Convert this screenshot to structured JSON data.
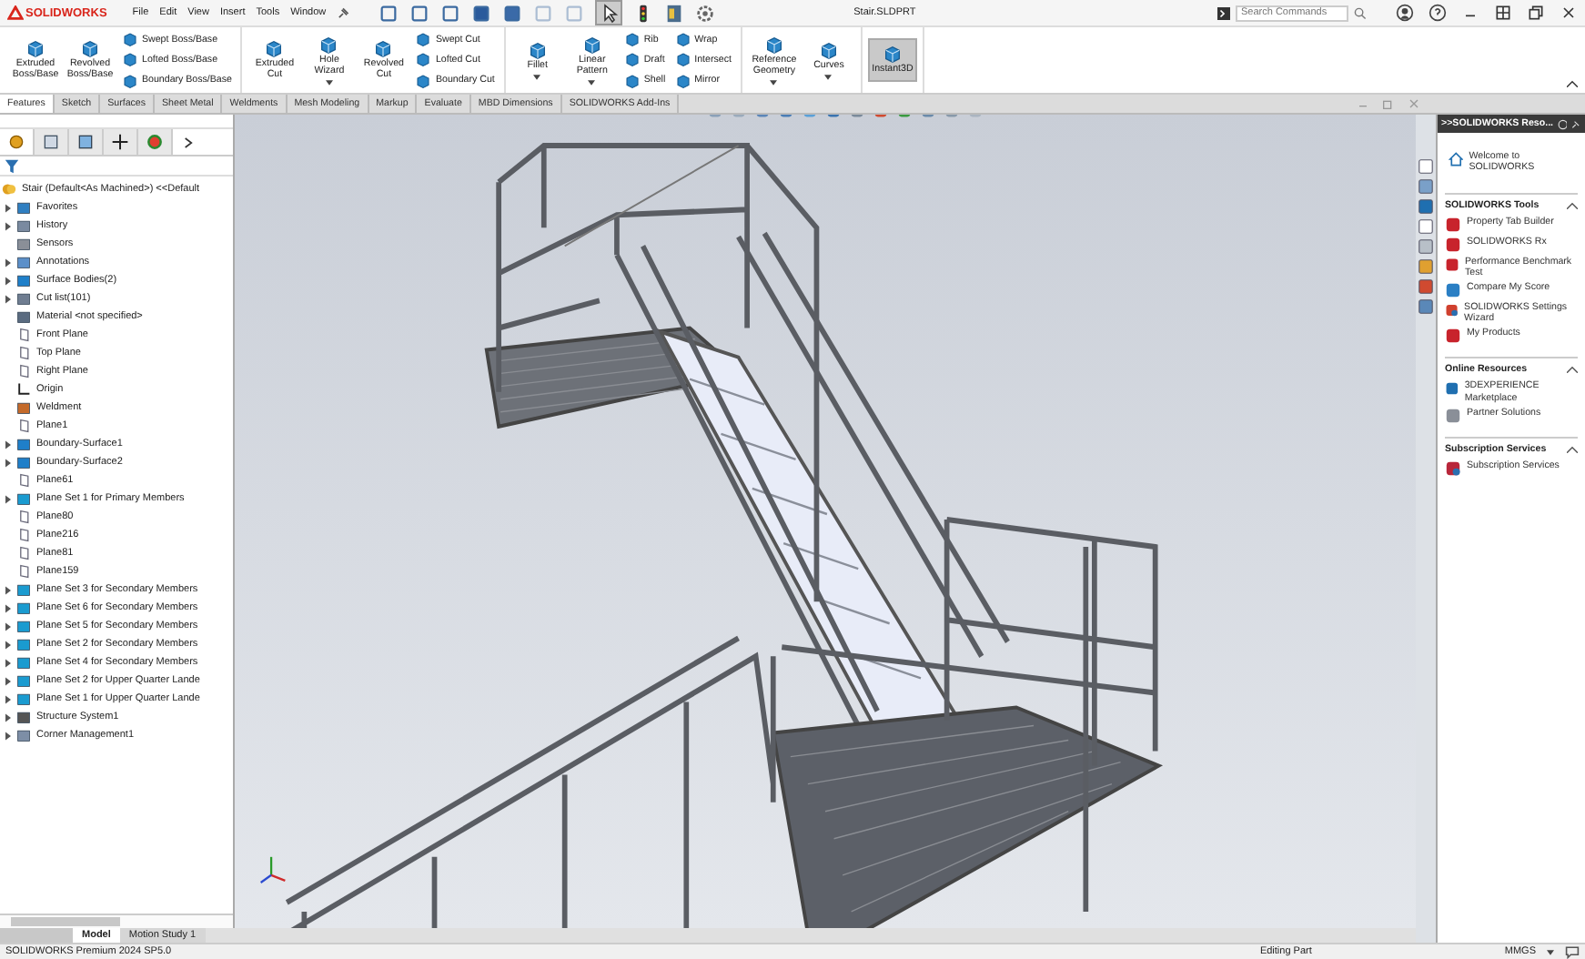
{
  "app": {
    "logo": "SOLIDWORKS",
    "menus": [
      "File",
      "Edit",
      "View",
      "Insert",
      "Tools",
      "Window"
    ],
    "title": "Stair.SLDPRT",
    "search": {
      "placeholder": "Search Commands"
    }
  },
  "ribbon": {
    "groups": [
      {
        "columns": [
          [
            {
              "label": "Extruded Boss/Base",
              "kind": "large",
              "dropdown": false
            }
          ],
          [
            {
              "label": "Revolved Boss/Base",
              "kind": "large",
              "dropdown": false
            }
          ],
          [
            {
              "label": "Swept Boss/Base",
              "kind": "small",
              "dropdown": false
            },
            {
              "label": "Lofted Boss/Base",
              "kind": "small",
              "dropdown": false
            },
            {
              "label": "Boundary Boss/Base",
              "kind": "small",
              "dropdown": false
            }
          ]
        ]
      },
      {
        "columns": [
          [
            {
              "label": "Extruded Cut",
              "kind": "large",
              "dropdown": false
            }
          ],
          [
            {
              "label": "Hole Wizard",
              "kind": "large",
              "dropdown": true
            }
          ],
          [
            {
              "label": "Revolved Cut",
              "kind": "large",
              "dropdown": false
            }
          ],
          [
            {
              "label": "Swept Cut",
              "kind": "small",
              "dropdown": false
            },
            {
              "label": "Lofted Cut",
              "kind": "small",
              "dropdown": false
            },
            {
              "label": "Boundary Cut",
              "kind": "small",
              "dropdown": false
            }
          ]
        ]
      },
      {
        "columns": [
          [
            {
              "label": "Fillet",
              "kind": "large",
              "dropdown": true
            }
          ],
          [
            {
              "label": "Linear Pattern",
              "kind": "large",
              "dropdown": true
            }
          ],
          [
            {
              "label": "Rib",
              "kind": "small",
              "dropdown": false
            },
            {
              "label": "Draft",
              "kind": "small",
              "dropdown": false
            },
            {
              "label": "Shell",
              "kind": "small",
              "dropdown": false
            }
          ],
          [
            {
              "label": "Wrap",
              "kind": "small",
              "dropdown": false
            },
            {
              "label": "Intersect",
              "kind": "small",
              "dropdown": false
            },
            {
              "label": "Mirror",
              "kind": "small",
              "dropdown": false
            }
          ]
        ]
      },
      {
        "columns": [
          [
            {
              "label": "Reference Geometry",
              "kind": "large",
              "dropdown": true
            }
          ],
          [
            {
              "label": "Curves",
              "kind": "large",
              "dropdown": true
            }
          ]
        ]
      },
      {
        "columns": [
          [
            {
              "label": "Instant3D",
              "kind": "large",
              "dropdown": false,
              "selected": true
            }
          ]
        ]
      }
    ]
  },
  "command_tabs": [
    {
      "label": "Features",
      "selected": true
    },
    {
      "label": "Sketch",
      "selected": false
    },
    {
      "label": "Surfaces",
      "selected": false
    },
    {
      "label": "Sheet Metal",
      "selected": false
    },
    {
      "label": "Weldments",
      "selected": false
    },
    {
      "label": "Mesh Modeling",
      "selected": false
    },
    {
      "label": "Markup",
      "selected": false
    },
    {
      "label": "Evaluate",
      "selected": false
    },
    {
      "label": "MBD Dimensions",
      "selected": false
    },
    {
      "label": "SOLIDWORKS Add-Ins",
      "selected": false
    }
  ],
  "panel_tabs": [
    {
      "selected": true
    },
    {
      "selected": false
    },
    {
      "selected": false
    },
    {
      "selected": false
    },
    {
      "selected": false
    }
  ],
  "tree": {
    "root": "Stair (Default<As Machined>) <<Default",
    "items": [
      {
        "label": "Favorites",
        "kind": "favorites",
        "expandable": true
      },
      {
        "label": "History",
        "kind": "history",
        "expandable": true
      },
      {
        "label": "Sensors",
        "kind": "sensors",
        "expandable": false
      },
      {
        "label": "Annotations",
        "kind": "annotations",
        "expandable": true
      },
      {
        "label": "Surface Bodies(2)",
        "kind": "surface",
        "expandable": true
      },
      {
        "label": "Cut list(101)",
        "kind": "cutlist",
        "expandable": true
      },
      {
        "label": "Material <not specified>",
        "kind": "material",
        "expandable": false
      },
      {
        "label": "Front Plane",
        "kind": "plane",
        "expandable": false
      },
      {
        "label": "Top Plane",
        "kind": "plane",
        "expandable": false
      },
      {
        "label": "Right Plane",
        "kind": "plane",
        "expandable": false
      },
      {
        "label": "Origin",
        "kind": "origin",
        "expandable": false
      },
      {
        "label": "Weldment",
        "kind": "weldment",
        "expandable": false
      },
      {
        "label": "Plane1",
        "kind": "plane",
        "expandable": false
      },
      {
        "label": "Boundary-Surface1",
        "kind": "surface",
        "expandable": true
      },
      {
        "label": "Boundary-Surface2",
        "kind": "surface",
        "expandable": true
      },
      {
        "label": "Plane61",
        "kind": "plane",
        "expandable": false
      },
      {
        "label": "Plane Set 1 for Primary Members",
        "kind": "planeset",
        "expandable": true
      },
      {
        "label": "Plane80",
        "kind": "plane",
        "expandable": false
      },
      {
        "label": "Plane216",
        "kind": "plane",
        "expandable": false
      },
      {
        "label": "Plane81",
        "kind": "plane",
        "expandable": false
      },
      {
        "label": "Plane159",
        "kind": "plane",
        "expandable": false
      },
      {
        "label": "Plane Set 3 for Secondary Members",
        "kind": "planeset",
        "expandable": true
      },
      {
        "label": "Plane Set 6 for Secondary Members",
        "kind": "planeset",
        "expandable": true
      },
      {
        "label": "Plane Set 5 for Secondary Members",
        "kind": "planeset",
        "expandable": true
      },
      {
        "label": "Plane Set 2 for Secondary Members",
        "kind": "planeset",
        "expandable": true
      },
      {
        "label": "Plane Set 4 for Secondary Members",
        "kind": "planeset",
        "expandable": true
      },
      {
        "label": "Plane Set 2 for Upper Quarter Lande",
        "kind": "planeset",
        "expandable": true
      },
      {
        "label": "Plane Set 1 for Upper Quarter Lande",
        "kind": "planeset",
        "expandable": true
      },
      {
        "label": "Structure System1",
        "kind": "structure",
        "expandable": true
      },
      {
        "label": "Corner Management1",
        "kind": "corner",
        "expandable": true
      }
    ]
  },
  "task_pane": {
    "title": ">>SOLIDWORKS Reso...",
    "welcome": "Welcome to SOLIDWORKS",
    "sections": [
      {
        "title": "SOLIDWORKS Tools",
        "expanded": true,
        "items": [
          {
            "label": "Property Tab Builder",
            "kind": "tool"
          },
          {
            "label": "SOLIDWORKS Rx",
            "kind": "tool"
          },
          {
            "label": "Performance Benchmark Test",
            "kind": "tool"
          },
          {
            "label": "Compare My Score",
            "kind": "score"
          },
          {
            "label": "SOLIDWORKS Settings Wizard",
            "kind": "wizard"
          },
          {
            "label": "My Products",
            "kind": "tool"
          }
        ]
      },
      {
        "title": "Online Resources",
        "expanded": true,
        "items": [
          {
            "label": "3DEXPERIENCE Marketplace",
            "kind": "market"
          },
          {
            "label": "Partner Solutions",
            "kind": "partner"
          }
        ]
      },
      {
        "title": "Subscription Services",
        "expanded": true,
        "items": [
          {
            "label": "Subscription Services",
            "kind": "subscription"
          }
        ]
      }
    ]
  },
  "bottom_tabs": [
    {
      "label": "Model",
      "selected": true
    },
    {
      "label": "Motion Study 1",
      "selected": false
    }
  ],
  "status_bar": {
    "product": "SOLIDWORKS Premium 2024 SP5.0",
    "mode": "Editing Part",
    "units": "MMGS"
  }
}
